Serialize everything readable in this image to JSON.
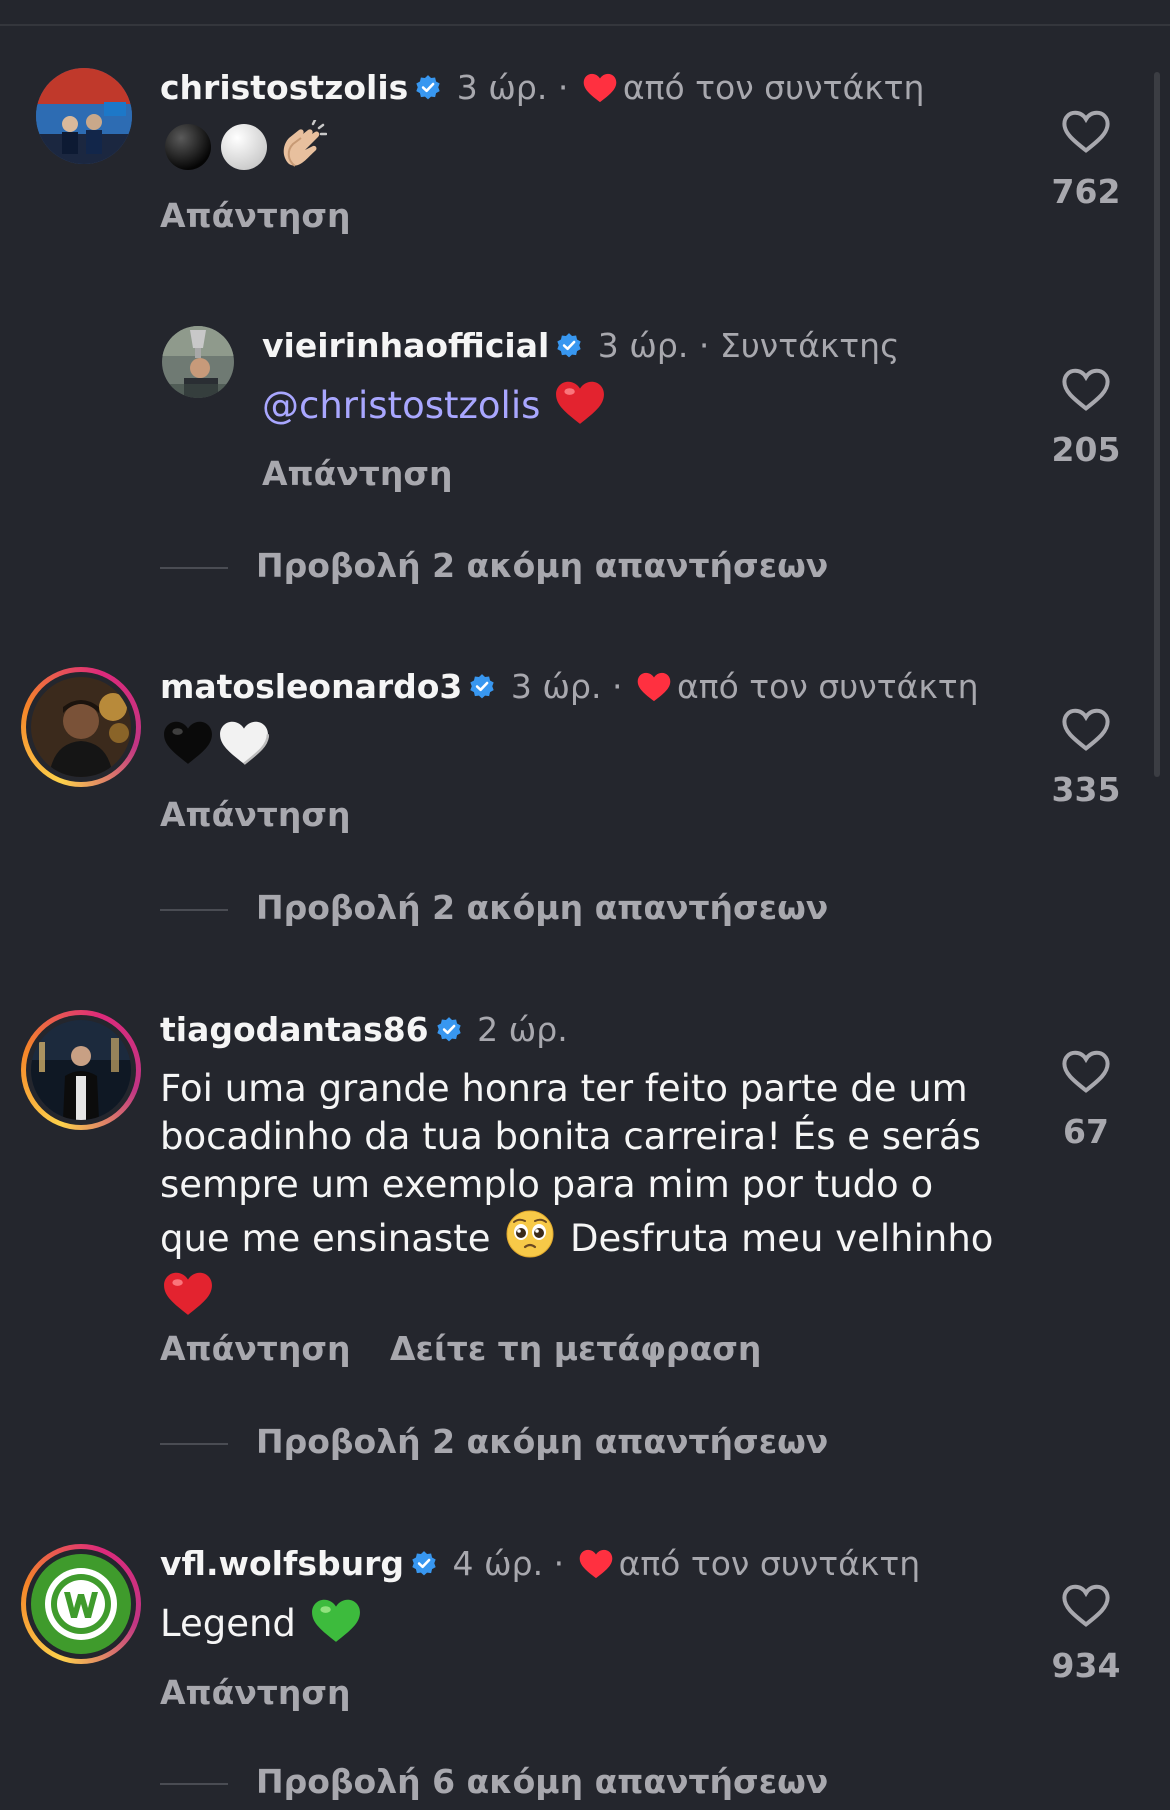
{
  "comments": [
    {
      "username": "christostzolis",
      "time": "3 ώρ.",
      "separator": "·",
      "author_like": "από τον συντάκτη",
      "reply": "Απάντηση",
      "likes": "762"
    },
    {
      "username": "vieirinhaofficial",
      "time": "3 ώρ.",
      "author_tag": "· Συντάκτης",
      "mention": "@christostzolis",
      "reply": "Απάντηση",
      "likes": "205"
    },
    {
      "username": "matosleonardo3",
      "time": "3 ώρ.",
      "separator": "·",
      "author_like": "από τον συντάκτη",
      "reply": "Απάντηση",
      "likes": "335"
    },
    {
      "username": "tiagodantas86",
      "time": "2 ώρ.",
      "text_part1": "Foi uma grande honra ter feito parte de um bocadinho da tua bonita carreira! És e serás sempre um exemplo para mim por tudo o que me ensinaste",
      "text_part2": "Desfruta meu velhinho",
      "reply": "Απάντηση",
      "translate": "Δείτε τη μετάφραση",
      "likes": "67"
    },
    {
      "username": "vfl.wolfsburg",
      "time": "4 ώρ.",
      "separator": "·",
      "author_like": "από τον συντάκτη",
      "text": "Legend",
      "reply": "Απάντηση",
      "likes": "934"
    }
  ],
  "view_more": [
    "Προβολή 2 ακόμη απαντήσεων",
    "Προβολή 2 ακόμη απαντήσεων",
    "Προβολή 2 ακόμη απαντήσεων",
    "Προβολή 6 ακόμη απαντήσεων"
  ],
  "icons": {
    "verified": "verified-badge-icon",
    "like": "heart-outline-icon",
    "author_like": "red-heart-icon"
  },
  "colors": {
    "background": "#24262d",
    "verified": "#3897f0",
    "author_heart": "#ff3040",
    "mention": "#a9a7ff",
    "secondary_text": "#a8a8ae"
  }
}
